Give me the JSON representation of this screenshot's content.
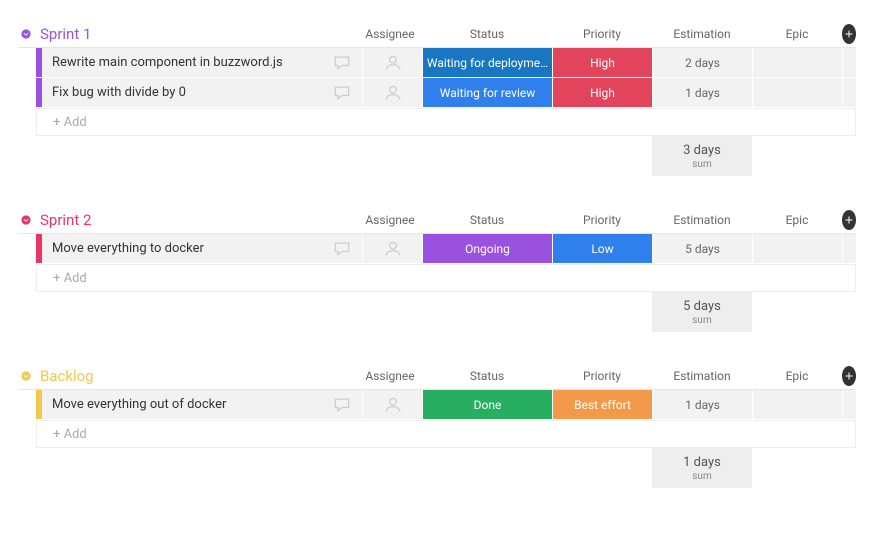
{
  "columns": {
    "assignee": "Assignee",
    "status": "Status",
    "priority": "Priority",
    "estimation": "Estimation",
    "epic": "Epic"
  },
  "add_label": "+ Add",
  "sum_label": "sum",
  "groups": [
    {
      "title": "Sprint 1",
      "color": "#9b51e0",
      "rows": [
        {
          "task": "Rewrite main component in buzzword.js",
          "status": {
            "label": "Waiting for deployme…",
            "color": "#1976c2"
          },
          "priority": {
            "label": "High",
            "color": "#e2445c"
          },
          "estimation": "2 days"
        },
        {
          "task": "Fix bug with divide by 0",
          "status": {
            "label": "Waiting for review",
            "color": "#2f80ed"
          },
          "priority": {
            "label": "High",
            "color": "#e2445c"
          },
          "estimation": "1 days"
        }
      ],
      "sum": "3 days"
    },
    {
      "title": "Sprint 2",
      "color": "#eb3569",
      "rows": [
        {
          "task": "Move everything to docker",
          "status": {
            "label": "Ongoing",
            "color": "#9b51e0"
          },
          "priority": {
            "label": "Low",
            "color": "#2f80ed"
          },
          "estimation": "5 days"
        }
      ],
      "sum": "5 days"
    },
    {
      "title": "Backlog",
      "color": "#f2c94c",
      "rows": [
        {
          "task": "Move everything out of docker",
          "status": {
            "label": "Done",
            "color": "#27ae60"
          },
          "priority": {
            "label": "Best effort",
            "color": "#f2994a"
          },
          "estimation": "1 days"
        }
      ],
      "sum": "1 days"
    }
  ]
}
